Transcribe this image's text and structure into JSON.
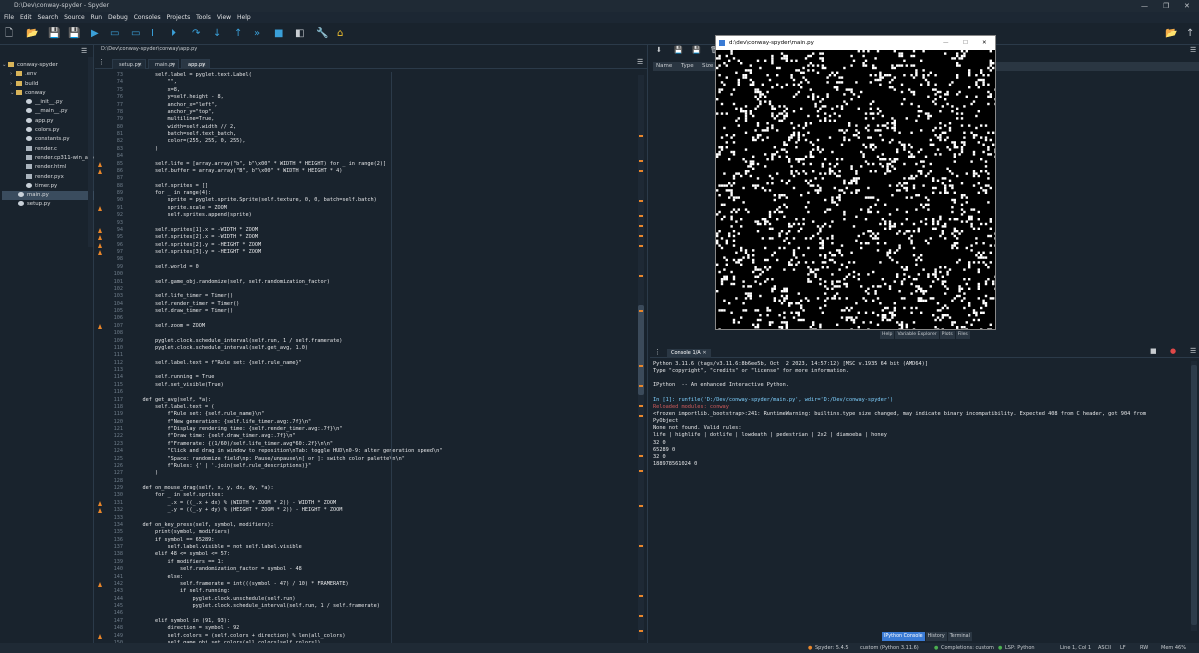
{
  "window": {
    "title": "D:\\Dev\\conway-spyder - Spyder"
  },
  "menu": [
    "File",
    "Edit",
    "Search",
    "Source",
    "Run",
    "Debug",
    "Consoles",
    "Projects",
    "Tools",
    "View",
    "Help"
  ],
  "files": {
    "items": [
      {
        "label": "conway-spyder",
        "indent": 0,
        "kind": "folder-open"
      },
      {
        "label": ".env",
        "indent": 1,
        "kind": "folder"
      },
      {
        "label": "build",
        "indent": 1,
        "kind": "folder"
      },
      {
        "label": "conway",
        "indent": 1,
        "kind": "folder-open"
      },
      {
        "label": "__init__.py",
        "indent": 2,
        "kind": "py"
      },
      {
        "label": "__main__.py",
        "indent": 2,
        "kind": "py"
      },
      {
        "label": "app.py",
        "indent": 2,
        "kind": "py"
      },
      {
        "label": "colors.py",
        "indent": 2,
        "kind": "py"
      },
      {
        "label": "constants.py",
        "indent": 2,
        "kind": "py"
      },
      {
        "label": "render.c",
        "indent": 2,
        "kind": "c"
      },
      {
        "label": "render.cp311-win_amd64.pyd",
        "indent": 2,
        "kind": "file"
      },
      {
        "label": "render.html",
        "indent": 2,
        "kind": "html"
      },
      {
        "label": "render.pyx",
        "indent": 2,
        "kind": "file"
      },
      {
        "label": "timer.py",
        "indent": 2,
        "kind": "py"
      },
      {
        "label": "main.py",
        "indent": 1,
        "kind": "py",
        "selected": true
      },
      {
        "label": "setup.py",
        "indent": 1,
        "kind": "py"
      }
    ]
  },
  "editor": {
    "path": "D:\\Dev\\conway-spyder\\conway\\app.py",
    "tabs": [
      {
        "label": "setup.py",
        "active": false
      },
      {
        "label": "main.py",
        "active": false
      },
      {
        "label": "app.py",
        "active": true
      }
    ],
    "lines": [
      {
        "n": "73",
        "t": "        self.label = pyglet.text.Label(",
        "w": false
      },
      {
        "n": "74",
        "t": "            \"\",",
        "w": false
      },
      {
        "n": "75",
        "t": "            x=8,",
        "w": false
      },
      {
        "n": "76",
        "t": "            y=self.height - 8,",
        "w": false
      },
      {
        "n": "77",
        "t": "            anchor_x=\"left\",",
        "w": false
      },
      {
        "n": "78",
        "t": "            anchor_y=\"top\",",
        "w": false
      },
      {
        "n": "79",
        "t": "            multiline=True,",
        "w": false
      },
      {
        "n": "80",
        "t": "            width=self.width // 2,",
        "w": false
      },
      {
        "n": "81",
        "t": "            batch=self.text_batch,",
        "w": false
      },
      {
        "n": "82",
        "t": "            color=(255, 255, 0, 255),",
        "w": false
      },
      {
        "n": "83",
        "t": "        )",
        "w": false
      },
      {
        "n": "84",
        "t": "",
        "w": false
      },
      {
        "n": "85",
        "t": "        self.life = [array.array(\"b\", b\"\\x00\" * WIDTH * HEIGHT) for _ in range(2)]",
        "w": true
      },
      {
        "n": "86",
        "t": "        self.buffer = array.array(\"B\", b\"\\x00\" * WIDTH * HEIGHT * 4)",
        "w": true
      },
      {
        "n": "87",
        "t": "",
        "w": false
      },
      {
        "n": "88",
        "t": "        self.sprites = []",
        "w": false
      },
      {
        "n": "89",
        "t": "        for _ in range(4):",
        "w": false
      },
      {
        "n": "90",
        "t": "            sprite = pyglet.sprite.Sprite(self.texture, 0, 0, batch=self.batch)",
        "w": false
      },
      {
        "n": "91",
        "t": "            sprite.scale = ZOOM",
        "w": true
      },
      {
        "n": "92",
        "t": "            self.sprites.append(sprite)",
        "w": false
      },
      {
        "n": "93",
        "t": "",
        "w": false
      },
      {
        "n": "94",
        "t": "        self.sprites[1].x = -WIDTH * ZOOM",
        "w": true
      },
      {
        "n": "95",
        "t": "        self.sprites[2].x = -WIDTH * ZOOM",
        "w": true
      },
      {
        "n": "96",
        "t": "        self.sprites[2].y = -HEIGHT * ZOOM",
        "w": true
      },
      {
        "n": "97",
        "t": "        self.sprites[3].y = -HEIGHT * ZOOM",
        "w": true
      },
      {
        "n": "98",
        "t": "",
        "w": false
      },
      {
        "n": "99",
        "t": "        self.world = 0",
        "w": false
      },
      {
        "n": "100",
        "t": "",
        "w": false
      },
      {
        "n": "101",
        "t": "        self.game_obj.randomize(self, self.randomization_factor)",
        "w": false
      },
      {
        "n": "102",
        "t": "",
        "w": false
      },
      {
        "n": "103",
        "t": "        self.life_timer = Timer()",
        "w": false
      },
      {
        "n": "104",
        "t": "        self.render_timer = Timer()",
        "w": false
      },
      {
        "n": "105",
        "t": "        self.draw_timer = Timer()",
        "w": false
      },
      {
        "n": "106",
        "t": "",
        "w": false
      },
      {
        "n": "107",
        "t": "        self.zoom = ZOOM",
        "w": true
      },
      {
        "n": "108",
        "t": "",
        "w": false
      },
      {
        "n": "109",
        "t": "        pyglet.clock.schedule_interval(self.run, 1 / self.framerate)",
        "w": false
      },
      {
        "n": "110",
        "t": "        pyglet.clock.schedule_interval(self.get_avg, 1.0)",
        "w": false
      },
      {
        "n": "111",
        "t": "",
        "w": false
      },
      {
        "n": "112",
        "t": "        self.label.text = f\"Rule set: {self.rule_name}\"",
        "w": false
      },
      {
        "n": "113",
        "t": "",
        "w": false
      },
      {
        "n": "114",
        "t": "        self.running = True",
        "w": false
      },
      {
        "n": "115",
        "t": "        self.set_visible(True)",
        "w": false
      },
      {
        "n": "116",
        "t": "",
        "w": false
      },
      {
        "n": "117",
        "t": "    def get_avg(self, *a):",
        "w": false
      },
      {
        "n": "118",
        "t": "        self.label.text = (",
        "w": false
      },
      {
        "n": "119",
        "t": "            f\"Rule set: {self.rule_name}\\n\"",
        "w": false
      },
      {
        "n": "120",
        "t": "            f\"New generation: {self.life_timer.avg:.7f}\\n\"",
        "w": false
      },
      {
        "n": "121",
        "t": "            f\"Display rendering time: {self.render_timer.avg:.7f}\\n\"",
        "w": false
      },
      {
        "n": "122",
        "t": "            f\"Draw time: {self.draw_timer.avg:.7f}\\n\"",
        "w": false
      },
      {
        "n": "123",
        "t": "            f\"Framerate: {(1/60)/self.life_timer.avg*60:.2f}\\n\\n\"",
        "w": false
      },
      {
        "n": "124",
        "t": "            \"Click and drag in window to reposition\\nTab: toggle HUD\\n0-9: alter generation speed\\n\"",
        "w": false
      },
      {
        "n": "125",
        "t": "            \"Space: randomize field\\np: Pause/unpause\\n[ or ]: switch color palette\\n\\n\"",
        "w": false
      },
      {
        "n": "126",
        "t": "            f\"Rules: {' | '.join(self.rule_descriptions)}\"",
        "w": false
      },
      {
        "n": "127",
        "t": "        )",
        "w": false
      },
      {
        "n": "128",
        "t": "",
        "w": false
      },
      {
        "n": "129",
        "t": "    def on_mouse_drag(self, x, y, dx, dy, *a):",
        "w": false
      },
      {
        "n": "130",
        "t": "        for _ in self.sprites:",
        "w": false
      },
      {
        "n": "131",
        "t": "            _.x = ((_.x + dx) % (WIDTH * ZOOM * 2)) - WIDTH * ZOOM",
        "w": true
      },
      {
        "n": "132",
        "t": "            _.y = ((_.y + dy) % (HEIGHT * ZOOM * 2)) - HEIGHT * ZOOM",
        "w": true
      },
      {
        "n": "133",
        "t": "",
        "w": false
      },
      {
        "n": "134",
        "t": "    def on_key_press(self, symbol, modifiers):",
        "w": false
      },
      {
        "n": "135",
        "t": "        print(symbol, modifiers)",
        "w": false
      },
      {
        "n": "136",
        "t": "        if symbol == 65289:",
        "w": false
      },
      {
        "n": "137",
        "t": "            self.label.visible = not self.label.visible",
        "w": false
      },
      {
        "n": "138",
        "t": "        elif 48 <= symbol <= 57:",
        "w": false
      },
      {
        "n": "139",
        "t": "            if modifiers == 1:",
        "w": false
      },
      {
        "n": "140",
        "t": "                self.randomization_factor = symbol - 48",
        "w": false
      },
      {
        "n": "141",
        "t": "            else:",
        "w": false
      },
      {
        "n": "142",
        "t": "                self.framerate = int(((symbol - 47) / 10) * FRAMERATE)",
        "w": true
      },
      {
        "n": "143",
        "t": "                if self.running:",
        "w": false
      },
      {
        "n": "144",
        "t": "                    pyglet.clock.unschedule(self.run)",
        "w": false
      },
      {
        "n": "145",
        "t": "                    pyglet.clock.schedule_interval(self.run, 1 / self.framerate)",
        "w": false
      },
      {
        "n": "146",
        "t": "",
        "w": false
      },
      {
        "n": "147",
        "t": "        elif symbol in (91, 93):",
        "w": false
      },
      {
        "n": "148",
        "t": "            direction = symbol - 92",
        "w": false
      },
      {
        "n": "149",
        "t": "            self.colors = (self.colors + direction) % len(all_colors)",
        "w": true
      },
      {
        "n": "150",
        "t": "            self.game_obj.set_colors(all_colors[self.colors])",
        "w": false
      },
      {
        "n": "151",
        "t": "            if not self.running:",
        "w": true
      },
      {
        "n": "152",
        "t": "                self.on_draw()",
        "w": false
      }
    ]
  },
  "variable_explorer": {
    "columns": [
      "Name",
      "Type",
      "Size"
    ],
    "tabs": [
      "Help",
      "Variable Explorer",
      "Plots",
      "Files"
    ]
  },
  "console": {
    "tab_label": "Console 1/A",
    "lines": [
      {
        "t": "Python 3.11.6 (tags/v3.11.6:8b6ee5b, Oct  2 2023, 14:57:12) [MSC v.1935 64 bit (AMD64)]",
        "c": "#e6e7e9"
      },
      {
        "t": "Type \"copyright\", \"credits\" or \"license\" for more information.",
        "c": "#e6e7e9"
      },
      {
        "t": "",
        "c": "#e6e7e9"
      },
      {
        "t": "IPython  -- An enhanced Interactive Python.",
        "c": "#e6e7e9"
      },
      {
        "t": "",
        "c": "#e6e7e9"
      },
      {
        "t": "In [1]: runfile('D:/Dev/conway-spyder/main.py', wdir='D:/Dev/conway-spyder')",
        "c": "#7fd1ff"
      },
      {
        "t": "Reloaded modules: conway",
        "c": "#d05b5b"
      },
      {
        "t": "<frozen importlib._bootstrap>:241: RuntimeWarning: builtins.type size changed, may indicate binary incompatibility. Expected 408 from C header, got 904 from",
        "c": "#e6e7e9"
      },
      {
        "t": "PyObject",
        "c": "#e6e7e9"
      },
      {
        "t": "None not found. Valid rules:",
        "c": "#e6e7e9"
      },
      {
        "t": "life | highlife | dotlife | lowdeath | pedestrian | 2x2 | diamoeba | honey",
        "c": "#e6e7e9"
      },
      {
        "t": "32 0",
        "c": "#e6e7e9"
      },
      {
        "t": "65289 0",
        "c": "#e6e7e9"
      },
      {
        "t": "32 0",
        "c": "#e6e7e9"
      },
      {
        "t": "188978561024 0",
        "c": "#e6e7e9"
      }
    ],
    "bottom_tabs": [
      {
        "label": "IPython Console",
        "on": true
      },
      {
        "label": "History",
        "on": false
      },
      {
        "label": "Terminal",
        "on": false
      }
    ]
  },
  "gamewindow": {
    "title": "d:\\dev\\conway-spyder\\main.py"
  },
  "statusbar": {
    "items": [
      "Spyder: 5.4.5",
      "custom (Python 3.11.6)",
      "Completions: custom",
      "LSP: Python",
      "Line 1, Col 1",
      "ASCII",
      "LF",
      "RW",
      "Mem 46%"
    ]
  }
}
